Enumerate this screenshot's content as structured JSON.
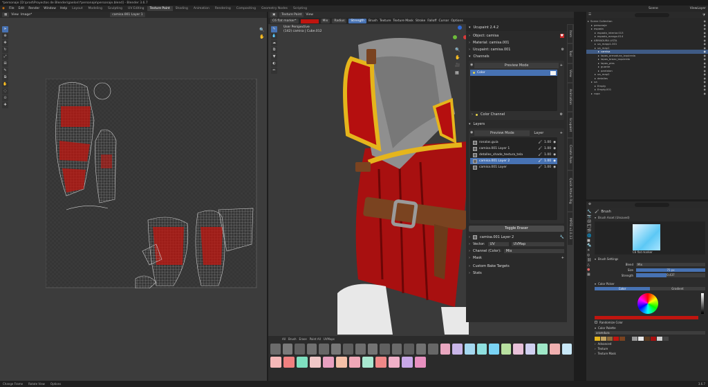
{
  "window": {
    "title": "*personaje [D:\\prod\\Proyectos de Blender\\gaelon\\*personaje\\personaje.blend] - Blender 3.6.7"
  },
  "menu": {
    "items": [
      "File",
      "Edit",
      "Render",
      "Window",
      "Help"
    ],
    "tabs": [
      "Layout",
      "Modeling",
      "Sculpting",
      "UV Editing",
      "Texture Paint",
      "Shading",
      "Animation",
      "Rendering",
      "Compositing",
      "Geometry Nodes",
      "Scripting"
    ],
    "active_tab": "Texture Paint",
    "scene": "Scene",
    "view_layer": "ViewLayer"
  },
  "uv_editor": {
    "view_label": "View",
    "image_label": "Image*",
    "image_name": "camisa.001 Layer 1"
  },
  "viewport": {
    "mode": "Texture Paint",
    "view_label": "View",
    "brush": "C6 flat marker*",
    "blend": "Mix",
    "radius_label": "Radius",
    "strength_label": "Strength",
    "brush_menu": "Brush",
    "texture_menu": "Texture",
    "texture_mask": "Texture Mask",
    "stroke": "Stroke",
    "falloff": "Falloff",
    "cursor": "Cursor",
    "options": "Options",
    "overlay_line1": "User Perspective",
    "overlay_line2": "(142) camisa | Cube.012",
    "layer_field": "camisa.001 Layer 2"
  },
  "ucupaint": {
    "title": "Ucupaint 2.4.2",
    "object": "Object: camisa",
    "material": "Material: camisa.001",
    "ucupaint_node": "Ucupaint: camisa.001",
    "channels_label": "Channels",
    "preview_mode": "Preview Mode",
    "channel_items": [
      "Color"
    ],
    "color_channel": "Color Channel",
    "layers_label": "Layers",
    "layer_tab": "Layer",
    "layers": [
      {
        "name": "ronalas.guia",
        "value": "1.00"
      },
      {
        "name": "camisa.001 Layer 1",
        "value": "1.00"
      },
      {
        "name": "detalles_shade_textura_tela",
        "value": "1.00"
      },
      {
        "name": "camisa.001 Layer 2",
        "value": "1.00",
        "selected": true
      },
      {
        "name": "camisa.001 Layer",
        "value": "1.00"
      }
    ],
    "toggle_eraser": "Toggle Eraser",
    "active_layer": "camisa.001 Layer 2",
    "vector_label": "Vector:",
    "vector_value": "UV",
    "uvmap": "UVMap",
    "channel_color_label": "Channel (Color):",
    "channel_color_value": "Mix",
    "mask": "Mask",
    "custom_bake": "Custom Bake Targets",
    "stats": "Stats"
  },
  "side_tabs": [
    "Item",
    "Tool",
    "View",
    "Animation",
    "Ucupaint",
    "Create Pose",
    "Quick Attach Rig",
    "MPFB v2.0.13"
  ],
  "asset_bar": {
    "tabs": [
      "All",
      "Brush",
      "Erase",
      "Paint All",
      "UVMaps"
    ]
  },
  "outliner": {
    "search_placeholder": "",
    "items": [
      {
        "name": "Scene Collection",
        "indent": 0
      },
      {
        "name": "personaje",
        "indent": 1
      },
      {
        "name": "espada",
        "indent": 1
      },
      {
        "name": "espada_interior.013",
        "indent": 2
      },
      {
        "name": "espada_mango.014",
        "indent": 2
      },
      {
        "name": "ARMADURA LISTA",
        "indent": 1
      },
      {
        "name": "ua_mapp1.001",
        "indent": 2
      },
      {
        "name": "ua_map1",
        "indent": 2
      },
      {
        "name": "camisa",
        "indent": 3,
        "selected": true
      },
      {
        "name": "lapas_armadura_izquierda",
        "indent": 3
      },
      {
        "name": "lapas_brazo_izquierdo",
        "indent": 3
      },
      {
        "name": "lapas_pies",
        "indent": 3
      },
      {
        "name": "guante",
        "indent": 3
      },
      {
        "name": "pantalon",
        "indent": 3
      },
      {
        "name": "ua_map2",
        "indent": 2
      },
      {
        "name": "detalles",
        "indent": 2
      },
      {
        "name": "ua",
        "indent": 1
      },
      {
        "name": "Empty",
        "indent": 2
      },
      {
        "name": "Empty.001",
        "indent": 2
      },
      {
        "name": "ropa",
        "indent": 1
      }
    ]
  },
  "properties": {
    "brush_label": "Brush",
    "brush_asset": "Brush Asset (Unsaved)",
    "brush_name": "C6 flat marker",
    "brush_settings": "Brush Settings",
    "blend_label": "Blend",
    "blend_value": "Mix",
    "size_label": "Size",
    "size_value": "75 px",
    "strength_label": "Strength",
    "strength_value": "0.437",
    "color_picker": "Color Picker",
    "color_tab": "Color",
    "gradient_tab": "Gradient",
    "randomize": "Randomize Color",
    "color_palette": "Color Palette",
    "palette_name": "aramdura",
    "advanced": "Advanced",
    "texture": "Texture",
    "texture_mask": "Texture Mask"
  },
  "status": {
    "left": "Change Frame",
    "mid": "Rotate View",
    "right": "Options",
    "version": "3.6.7"
  },
  "colors": {
    "accent": "#4772b3",
    "paint_red": "#c0150f",
    "panel": "#303030"
  }
}
